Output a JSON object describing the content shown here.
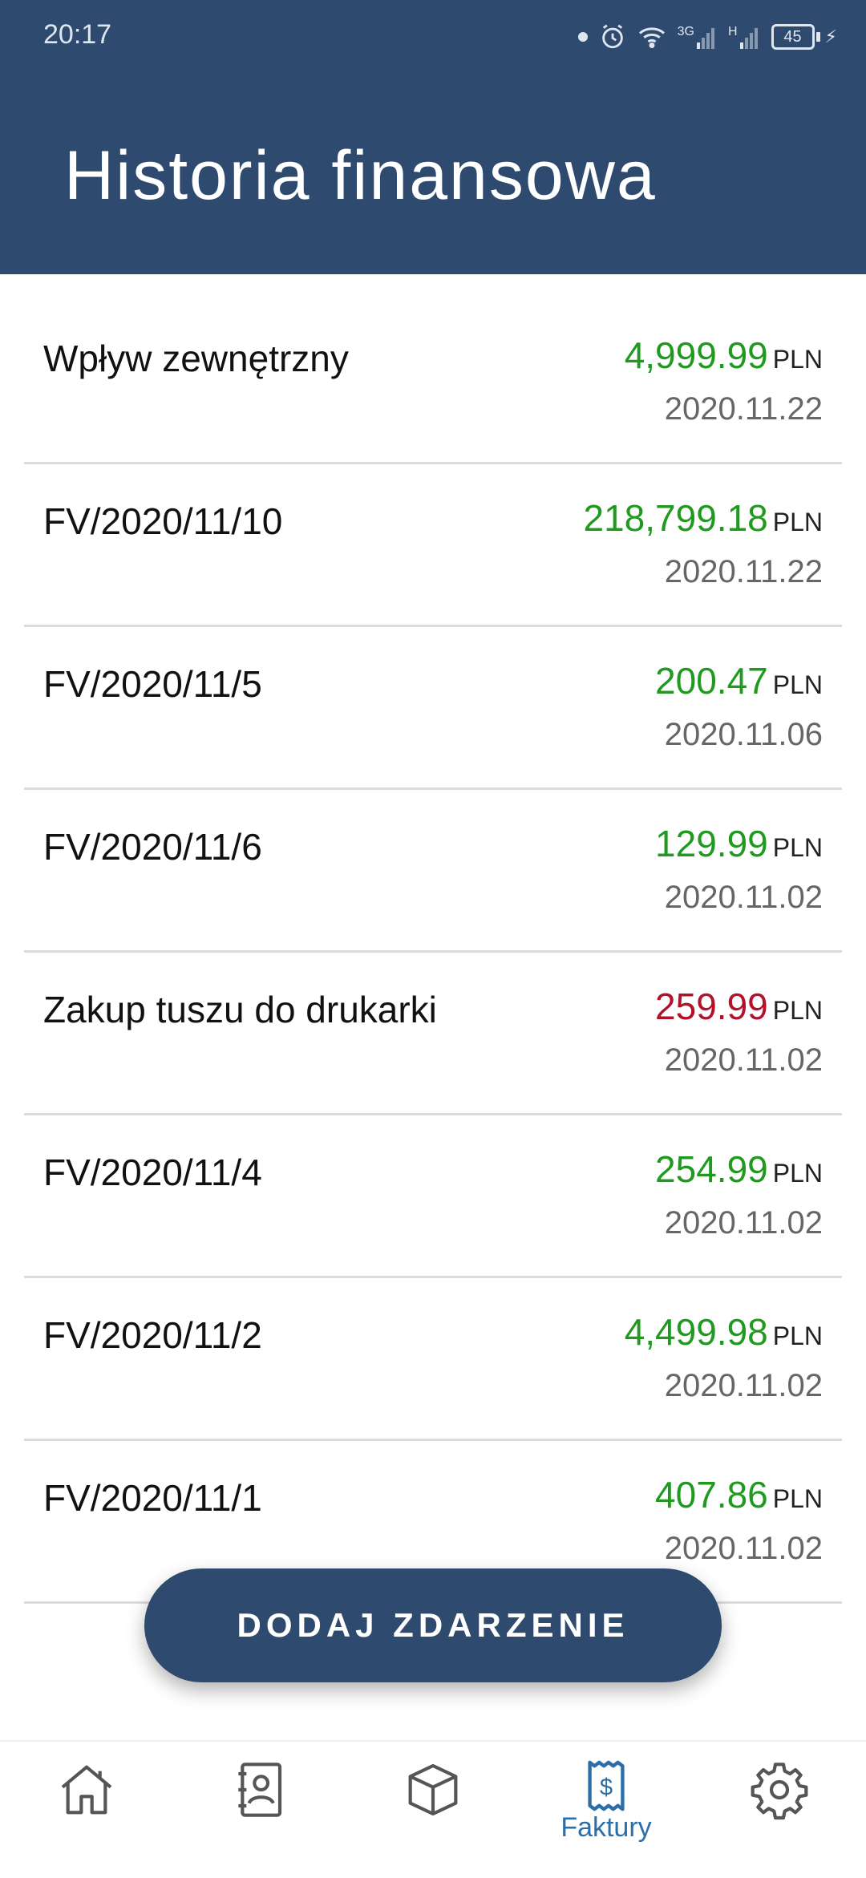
{
  "status_bar": {
    "time": "20:17",
    "network_3g": "3G",
    "network_h": "H",
    "battery": "45"
  },
  "header": {
    "title": "Historia finansowa"
  },
  "transactions": [
    {
      "name": "Wpływ zewnętrzny",
      "amount": "4,999.99",
      "currency": "PLN",
      "date": "2020.11.22",
      "type": "income"
    },
    {
      "name": "FV/2020/11/10",
      "amount": "218,799.18",
      "currency": "PLN",
      "date": "2020.11.22",
      "type": "income"
    },
    {
      "name": "FV/2020/11/5",
      "amount": "200.47",
      "currency": "PLN",
      "date": "2020.11.06",
      "type": "income"
    },
    {
      "name": "FV/2020/11/6",
      "amount": "129.99",
      "currency": "PLN",
      "date": "2020.11.02",
      "type": "income"
    },
    {
      "name": "Zakup tuszu do drukarki",
      "amount": "259.99",
      "currency": "PLN",
      "date": "2020.11.02",
      "type": "expense"
    },
    {
      "name": "FV/2020/11/4",
      "amount": "254.99",
      "currency": "PLN",
      "date": "2020.11.02",
      "type": "income"
    },
    {
      "name": "FV/2020/11/2",
      "amount": "4,499.98",
      "currency": "PLN",
      "date": "2020.11.02",
      "type": "income"
    },
    {
      "name": "FV/2020/11/1",
      "amount": "407.86",
      "currency": "PLN",
      "date": "2020.11.02",
      "type": "income"
    }
  ],
  "add_button": {
    "label": "DODAJ ZDARZENIE"
  },
  "bottom_nav": {
    "items": [
      {
        "icon": "home-icon",
        "label": "",
        "active": false
      },
      {
        "icon": "contacts-book-icon",
        "label": "",
        "active": false
      },
      {
        "icon": "package-box-icon",
        "label": "",
        "active": false
      },
      {
        "icon": "invoice-receipt-icon",
        "label": "Faktury",
        "active": true
      },
      {
        "icon": "settings-gear-icon",
        "label": "",
        "active": false
      }
    ]
  },
  "colors": {
    "header_bg": "#2f4a6f",
    "income": "#1f9a1f",
    "expense": "#b3112a",
    "active_nav": "#2b6ea8"
  }
}
